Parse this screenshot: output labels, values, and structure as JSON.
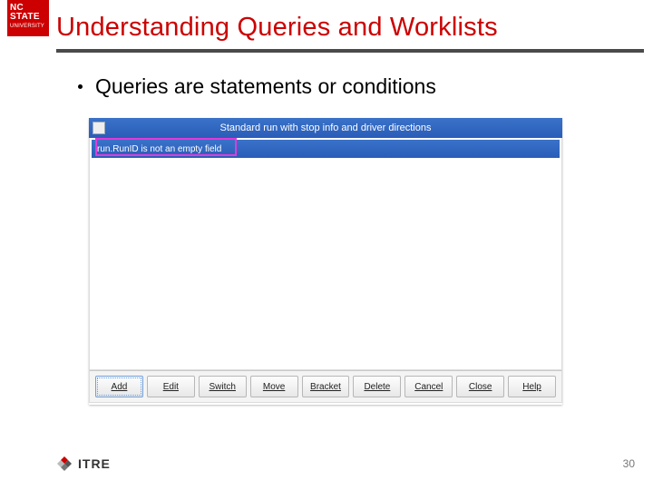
{
  "branding": {
    "ncstate_line1": "NC STATE",
    "ncstate_line2": "UNIVERSITY",
    "itre_text": "ITRE"
  },
  "slide": {
    "title": "Understanding Queries and Worklists",
    "bullet": "Queries are statements or conditions",
    "page_number": "30"
  },
  "dialog": {
    "title": "Standard run with stop info and driver directions",
    "condition_text": "run.RunID  is not an empty field",
    "buttons": {
      "add": "Add",
      "edit": "Edit",
      "switch": "Switch",
      "move": "Move",
      "bracket": "Bracket",
      "delete": "Delete",
      "cancel": "Cancel",
      "close": "Close",
      "help": "Help"
    }
  }
}
